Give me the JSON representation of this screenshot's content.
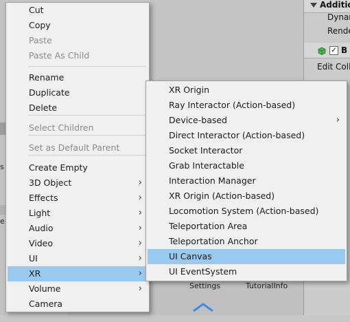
{
  "inspector": {
    "row1": "Additio",
    "row2": "Dynan",
    "row3": "Rende",
    "row4_component": "B",
    "row5": "Edit Colli"
  },
  "project": {
    "settings_label": "Settings",
    "tutorial_label": "TutorialInfo"
  },
  "left_fragments": {
    "a": "s",
    "b": "e"
  },
  "context_menu": {
    "items": [
      {
        "label": "Cut"
      },
      {
        "label": "Copy"
      },
      {
        "label": "Paste",
        "disabled": true
      },
      {
        "label": "Paste As Child",
        "disabled": true
      },
      {
        "label": "Rename"
      },
      {
        "label": "Duplicate"
      },
      {
        "label": "Delete"
      },
      {
        "label": "Select Children",
        "disabled": true
      },
      {
        "label": "Set as Default Parent",
        "disabled": true
      },
      {
        "label": "Create Empty"
      },
      {
        "label": "3D Object",
        "submenu": true
      },
      {
        "label": "Effects",
        "submenu": true
      },
      {
        "label": "Light",
        "submenu": true
      },
      {
        "label": "Audio",
        "submenu": true
      },
      {
        "label": "Video",
        "submenu": true
      },
      {
        "label": "UI",
        "submenu": true
      },
      {
        "label": "XR",
        "submenu": true,
        "highlighted": true
      },
      {
        "label": "Volume",
        "submenu": true
      },
      {
        "label": "Camera"
      }
    ],
    "submenu_arrow": "›"
  },
  "xr_submenu": {
    "items": [
      {
        "label": "XR Origin"
      },
      {
        "label": "Ray Interactor (Action-based)"
      },
      {
        "label": "Device-based",
        "submenu": true
      },
      {
        "label": "Direct Interactor (Action-based)"
      },
      {
        "label": "Socket Interactor"
      },
      {
        "label": "Grab Interactable"
      },
      {
        "label": "Interaction Manager"
      },
      {
        "label": "XR Origin (Action-based)"
      },
      {
        "label": "Locomotion System (Action-based)"
      },
      {
        "label": "Teleportation Area"
      },
      {
        "label": "Teleportation Anchor"
      },
      {
        "label": "UI Canvas",
        "highlighted": true
      },
      {
        "label": "UI EventSystem"
      }
    ]
  },
  "colors": {
    "highlight": "#99c9ef",
    "menu_bg": "#f0f0f0",
    "disabled_text": "#8a8a8a"
  }
}
